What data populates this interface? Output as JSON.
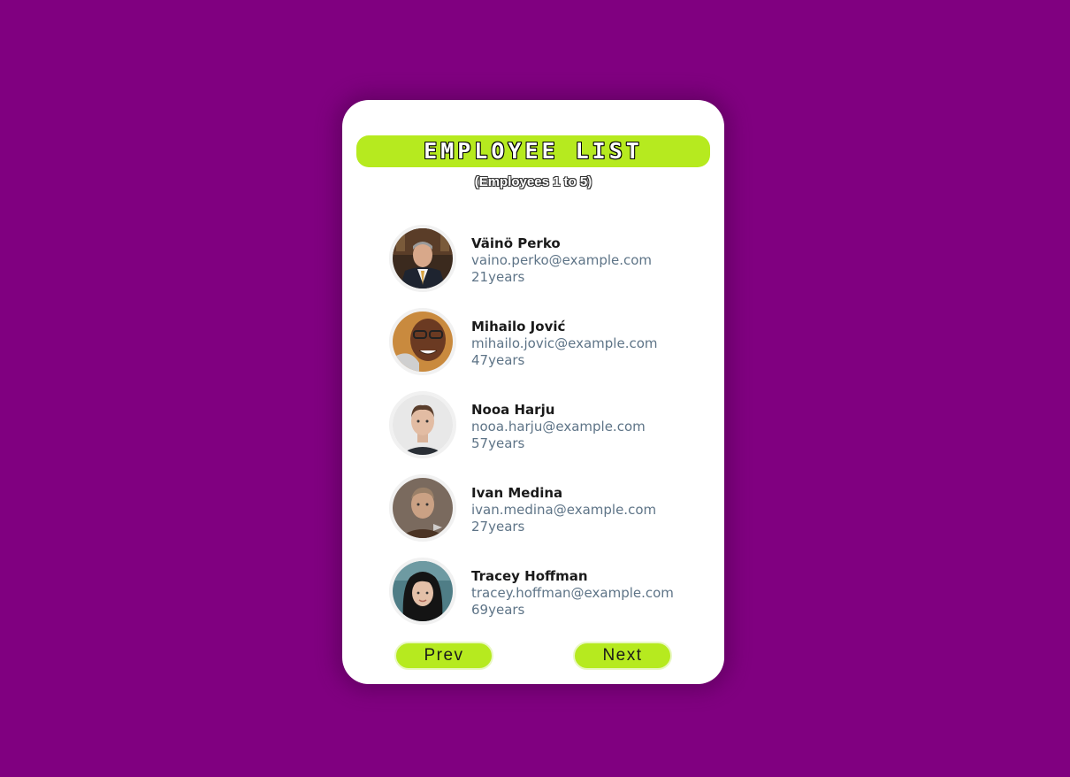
{
  "header": {
    "title": "EMPLOYEE LIST",
    "subtitle": "(Employees 1 to 5)"
  },
  "employees": [
    {
      "name": "Väinö Perko",
      "email": "vaino.perko@example.com",
      "age": "21years",
      "avatar": "man-in-suit-photo"
    },
    {
      "name": "Mihailo Jović",
      "email": "mihailo.jovic@example.com",
      "age": "47years",
      "avatar": "smiling-man-glasses-photo"
    },
    {
      "name": "Nooa Harju",
      "email": "nooa.harju@example.com",
      "age": "57years",
      "avatar": "young-man-photo"
    },
    {
      "name": "Ivan Medina",
      "email": "ivan.medina@example.com",
      "age": "27years",
      "avatar": "man-brown-shirt-photo"
    },
    {
      "name": "Tracey Hoffman",
      "email": "tracey.hoffman@example.com",
      "age": "69years",
      "avatar": "woman-dark-hair-photo"
    }
  ],
  "pagination": {
    "prev_label": "Prev",
    "next_label": "Next"
  },
  "colors": {
    "background": "#800080",
    "accent": "#b6ea1f",
    "card": "#ffffff",
    "email_text": "#5e7487"
  }
}
